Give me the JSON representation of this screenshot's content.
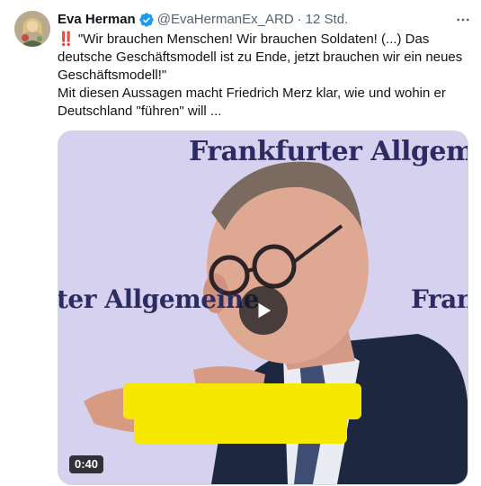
{
  "author": {
    "name": "Eva Herman",
    "handle": "@EvaHermanEx_ARD",
    "time": "12 Std.",
    "separator": "·",
    "verified": true,
    "avatar": "avatar-photo"
  },
  "tweet": {
    "emoji": "‼️",
    "line1": " \"Wir brauchen Menschen! Wir brauchen Soldaten! (...) Das deutsche Geschäftsmodell ist zu Ende, jetzt brauchen wir ein neues Geschäftsmodell!\"",
    "line2": "Mit diesen Aussagen macht Friedrich Merz klar, wie und wohin er Deutschland \"führen\" will ..."
  },
  "media": {
    "type": "video",
    "duration": "0:40",
    "watermark_top": "Frankfurter Allgemeine",
    "watermark_left": "ter Allgemeine",
    "watermark_right": "Fran",
    "play_icon": "play-icon"
  },
  "icons": {
    "more": "more-icon",
    "verified": "verified-badge-icon"
  },
  "colors": {
    "verified": "#1d9bf0",
    "backdrop": "#d6d1ee",
    "watermark": "#2d2b63",
    "redaction": "#f7e800"
  }
}
